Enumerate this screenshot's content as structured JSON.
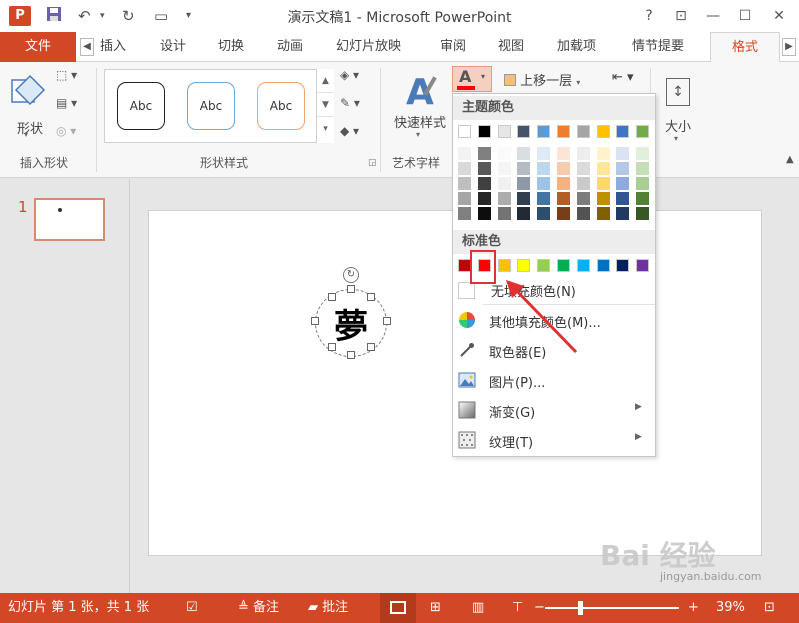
{
  "window": {
    "title": "演示文稿1 - Microsoft PowerPoint",
    "app_icon_letter": "P",
    "help": "?",
    "ribbon_display": "⊡",
    "minimize": "—",
    "maximize": "☐",
    "close": "✕"
  },
  "tabs": [
    {
      "label": "文件"
    },
    {
      "label": "插入"
    },
    {
      "label": "设计"
    },
    {
      "label": "切换"
    },
    {
      "label": "动画"
    },
    {
      "label": "幻灯片放映"
    },
    {
      "label": "审阅"
    },
    {
      "label": "视图"
    },
    {
      "label": "加载项"
    },
    {
      "label": "情节提要"
    },
    {
      "label": "格式"
    }
  ],
  "ribbon": {
    "shape_button_label": "形状",
    "group_insert_shapes": "插入形状",
    "group_shape_styles": "形状样式",
    "group_wordart": "艺术字样",
    "abc": [
      "Abc",
      "Abc",
      "Abc"
    ],
    "quick_style_label": "快速样式",
    "bring_forward_label": "上移一层",
    "size_label": "大小"
  },
  "slide_pane": {
    "number": "1"
  },
  "slide": {
    "glyph": "夢"
  },
  "dropdown": {
    "theme_header": "主题颜色",
    "standard_header": "标准色",
    "no_fill": "无填充颜色(N)",
    "menu": [
      {
        "label": "其他填充颜色(M)...",
        "icon": "color-wheel-icon"
      },
      {
        "label": "取色器(E)",
        "icon": "eyedropper-icon"
      },
      {
        "label": "图片(P)...",
        "icon": "picture-icon"
      },
      {
        "label": "渐变(G)",
        "icon": "gradient-icon"
      },
      {
        "label": "纹理(T)",
        "icon": "texture-icon"
      }
    ],
    "theme_colors": [
      "#ffffff",
      "#000000",
      "#e7e6e6",
      "#44546a",
      "#5b9bd5",
      "#ed7d31",
      "#a5a5a5",
      "#ffc000",
      "#4472c4",
      "#70ad47"
    ],
    "standard_colors": [
      "#c00000",
      "#ff0000",
      "#ffc000",
      "#ffff00",
      "#92d050",
      "#00b050",
      "#00b0f0",
      "#0070c0",
      "#002060",
      "#7030a0"
    ]
  },
  "status": {
    "slide_info": "幻灯片 第 1 张，共 1 张",
    "notes": "备注",
    "comments": "批注",
    "zoom": "39%"
  },
  "watermark": {
    "text": "Bai 经验",
    "url": "jingyan.baidu.com"
  }
}
